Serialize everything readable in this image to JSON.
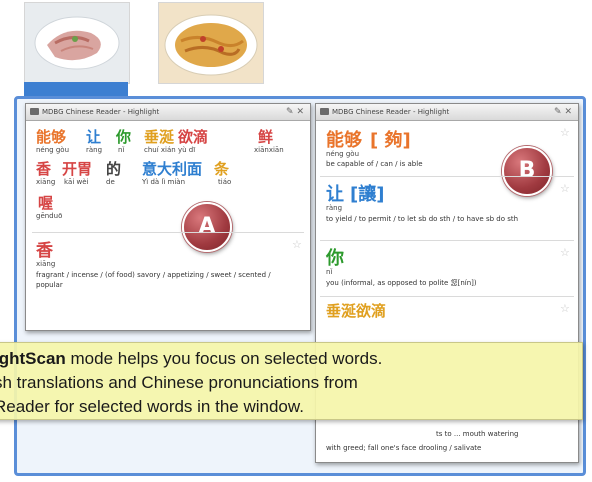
{
  "thumbnails": [
    {
      "caption": "",
      "icon": "plate-dish-image"
    },
    {
      "caption": "",
      "icon": "noodles-dish-image"
    }
  ],
  "window_a": {
    "title": "MDBG Chinese Reader - Highlight",
    "row1": {
      "words": [
        {
          "cn": "能够",
          "py": "néng gòu",
          "color": "#e9742b"
        },
        {
          "cn": "让",
          "py": "ràng",
          "color": "#2f7fd0"
        },
        {
          "cn": "你",
          "py": "nǐ",
          "color": "#2d9a2d"
        },
        {
          "cn": "垂涎",
          "py": "chuí xián",
          "color": "#e0a020"
        },
        {
          "cn": "欲滴",
          "py": "yù dī",
          "color": "#d64545"
        },
        {
          "cn": "鲜",
          "py": "xiānxiān",
          "color": "#d64545"
        }
      ]
    },
    "row2": {
      "words": [
        {
          "cn": "香",
          "py": "xiāng",
          "color": "#d64545"
        },
        {
          "cn": "开胃",
          "py": "kāi wèi",
          "color": "#d64545"
        },
        {
          "cn": "的",
          "py": "de",
          "color": "#444444"
        },
        {
          "cn": "意大利面",
          "py": "Yì dà lì miàn",
          "color": "#2f7fd0"
        },
        {
          "cn": "条",
          "py": "tiáo",
          "color": "#e0a020"
        }
      ]
    },
    "row3": {
      "cn": "喔",
      "py": "gēnduō",
      "color": "#d64545"
    },
    "entry": {
      "cn": "香",
      "py": "xiāng",
      "def": "fragrant / incense / (of food) savory / appetizing / sweet / scented / popular",
      "color": "#d64545"
    },
    "badge": "A"
  },
  "window_b": {
    "title": "MDBG Chinese Reader - Highlight",
    "entries": [
      {
        "cn": "能够",
        "trad": "[ 夠]",
        "py": "néng gòu",
        "def": "be capable of / can / is able",
        "color": "#e9742b"
      },
      {
        "cn": "让",
        "trad": "[讓]",
        "py": "ràng",
        "def": "to yield / to permit / to let sb do sth / to have sb do sth",
        "color": "#2f7fd0"
      },
      {
        "cn": "你",
        "trad": "",
        "py": "nǐ",
        "def": "you (informal, as opposed to polite 您[nín])",
        "color": "#2d9a2d"
      }
    ],
    "partial_entry": {
      "cn": "垂涎欲滴",
      "color": "#e0a020"
    },
    "bottom_defs": [
      "ts to ... mouth watering",
      "with greed; fall one's face drooling / salivate"
    ],
    "badge": "B"
  },
  "callout": {
    "line1_bold": "ightScan",
    "line1_rest": " mode helps you focus on selected words.",
    "line2": "sh translations and Chinese pronunciations from",
    "line3": "Reader for selected words in the window."
  }
}
